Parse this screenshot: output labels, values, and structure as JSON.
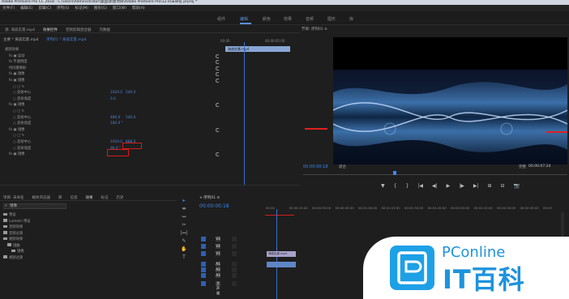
{
  "titlebar": {
    "text": "Adobe Premiere Pro CC 2018 - C:\\Users\\Administrator\\桌面\\新建项目\\Adobe Premiere Pro\\12.0\\未命名.prproj *"
  },
  "menu": [
    "文件(F)",
    "编辑(E)",
    "剪辑(C)",
    "序列(S)",
    "标记(M)",
    "图形(G)",
    "窗口(W)",
    "帮助(H)"
  ],
  "workspaces": [
    "组件",
    "编辑",
    "颜色",
    "效果",
    "音频",
    "图形",
    "库"
  ],
  "active_workspace": "编辑",
  "effect_controls": {
    "tabs": [
      "源: 海浪实景.mp4",
      "效果控件",
      "音频剪辑混合器",
      "元数据",
      "元数据"
    ],
    "source": "主要 * 海浪实景.mp4",
    "clip_link": "序列01 * 海浪实景.mp4",
    "ruler_start": "00:00",
    "ruler_end": "00:00:05:00",
    "clip_name": "海浪实景.mp4",
    "rows": [
      {
        "label": "视频效果",
        "indent": 0,
        "v1": "",
        "v2": ""
      },
      {
        "label": "fx ▣ 运动",
        "indent": 1,
        "v1": "",
        "v2": ""
      },
      {
        "label": "fx 不透明度",
        "indent": 1,
        "v1": "",
        "v2": ""
      },
      {
        "label": "时间重映射",
        "indent": 1,
        "v1": "",
        "v2": ""
      },
      {
        "label": "fx ▣ 镜像",
        "indent": 1,
        "v1": "",
        "v2": ""
      },
      {
        "label": "fx ▣ 镜像",
        "indent": 1,
        "v1": "",
        "v2": ""
      },
      {
        "label": "○ ▢ ✎",
        "indent": 2,
        "v1": "",
        "v2": ""
      },
      {
        "label": "○ 反射中心",
        "indent": 2,
        "v1": "1920.0",
        "v2": "540.0"
      },
      {
        "label": "○ 反射角度",
        "indent": 2,
        "v1": "0.0",
        "v2": ""
      },
      {
        "label": "fx ▣ 镜像",
        "indent": 1,
        "v1": "",
        "v2": ""
      },
      {
        "label": "○ ▢ ✎",
        "indent": 2,
        "v1": "",
        "v2": ""
      },
      {
        "label": "○ 反射中心",
        "indent": 2,
        "v1": "480.0",
        "v2": "540.0"
      },
      {
        "label": "○ 反射角度",
        "indent": 2,
        "v1": "180.0 °",
        "v2": ""
      },
      {
        "label": "fx ▣ 镜像",
        "indent": 1,
        "v1": "",
        "v2": ""
      },
      {
        "label": "○ ▢ ✎",
        "indent": 2,
        "v1": "",
        "v2": ""
      },
      {
        "label": "○ 反射中心",
        "indent": 2,
        "v1": "1920.0",
        "v2": "888.0"
      },
      {
        "label": "○ 反射角度",
        "indent": 2,
        "v1": "90.0 °",
        "v2": ""
      },
      {
        "label": "fx ▣ 镜像",
        "indent": 1,
        "v1": "",
        "v2": ""
      }
    ]
  },
  "program_monitor": {
    "title": "节目: 序列01 ≡",
    "timecode": "00:00:00:18",
    "fit": "适合",
    "quality": "完整",
    "duration": "00:00:07:24",
    "controls": [
      "▼",
      "{",
      "}",
      "|◀",
      "◀|",
      "▶",
      "|▶",
      "▶|",
      "⊞",
      "⊟",
      "📷"
    ]
  },
  "effects_panel": {
    "tabs": [
      "项目: 未命名",
      "媒体浏览器",
      "库",
      "信息",
      "效果",
      "标记",
      "历史"
    ],
    "active_tab": "效果",
    "search_value": "镜像",
    "items": [
      {
        "label": "预设",
        "indent": 0
      },
      {
        "label": "Lumetri 预设",
        "indent": 0
      },
      {
        "label": "音频效果",
        "indent": 0
      },
      {
        "label": "音频过渡",
        "indent": 0
      },
      {
        "label": "视频效果",
        "indent": 0
      },
      {
        "label": "扭曲",
        "indent": 1
      },
      {
        "label": "镜像",
        "indent": 2
      },
      {
        "label": "视频过渡",
        "indent": 0
      }
    ]
  },
  "timeline": {
    "title": "× 序列01 ≡",
    "timecode": "00:00:00:18",
    "ruler": [
      "00:00",
      "00:00:15:00",
      "00:00:30:00",
      "00:00:45:00",
      "00:01:00:00",
      "00:01:15:00",
      "00:01:30:00",
      "00:01:45:00",
      "00:02:00:00",
      "00:02:15:00",
      "00:02:30:00",
      "00:02:45:00",
      "00:03"
    ],
    "tracks": [
      "V3",
      "V2",
      "V1",
      "A1",
      "A2",
      "A3",
      "主声道"
    ],
    "master_value": "0.0",
    "video_clip": "海浪实景.mp4"
  },
  "tools": [
    "▸",
    "⇼",
    "↔",
    "✂",
    "|↔|",
    "✎",
    "✋",
    "T"
  ],
  "watermark": {
    "brand": "PConline",
    "slogan": "IT百科"
  },
  "colors": {
    "accent": "#3d86f0",
    "annotation": "#d81a1a",
    "logo": "#1e93dc"
  }
}
